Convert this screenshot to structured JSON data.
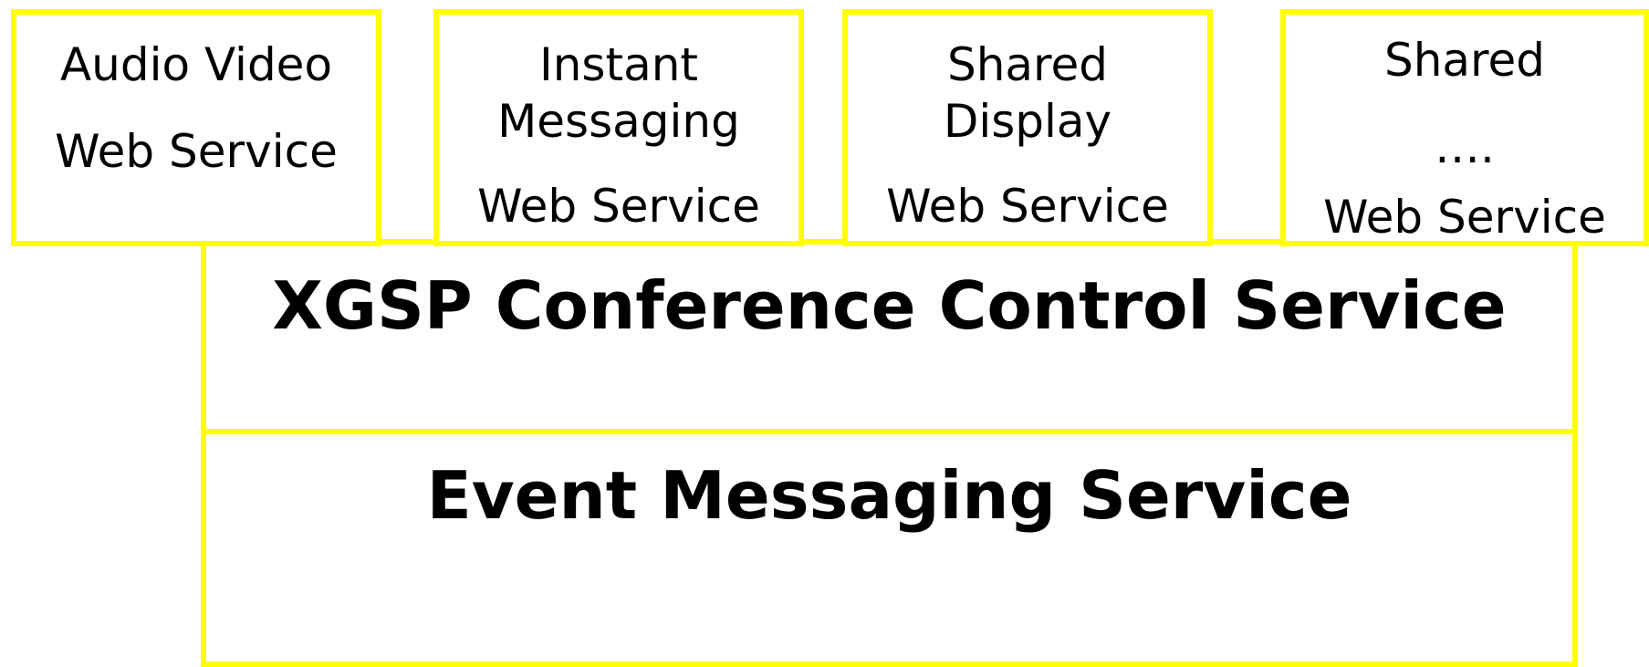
{
  "colors": {
    "border": "#ffff00",
    "text": "#000000",
    "background": "#ffffff"
  },
  "services": [
    {
      "lines": [
        "Audio Video",
        "Web Service"
      ]
    },
    {
      "lines": [
        "Instant",
        "Messaging",
        "Web Service"
      ]
    },
    {
      "lines": [
        "Shared",
        "Display",
        "Web Service"
      ]
    },
    {
      "lines": [
        "Shared",
        "….",
        "Web Service"
      ]
    }
  ],
  "layers": {
    "conference_control": "XGSP Conference Control Service",
    "event_messaging": "Event Messaging Service"
  }
}
